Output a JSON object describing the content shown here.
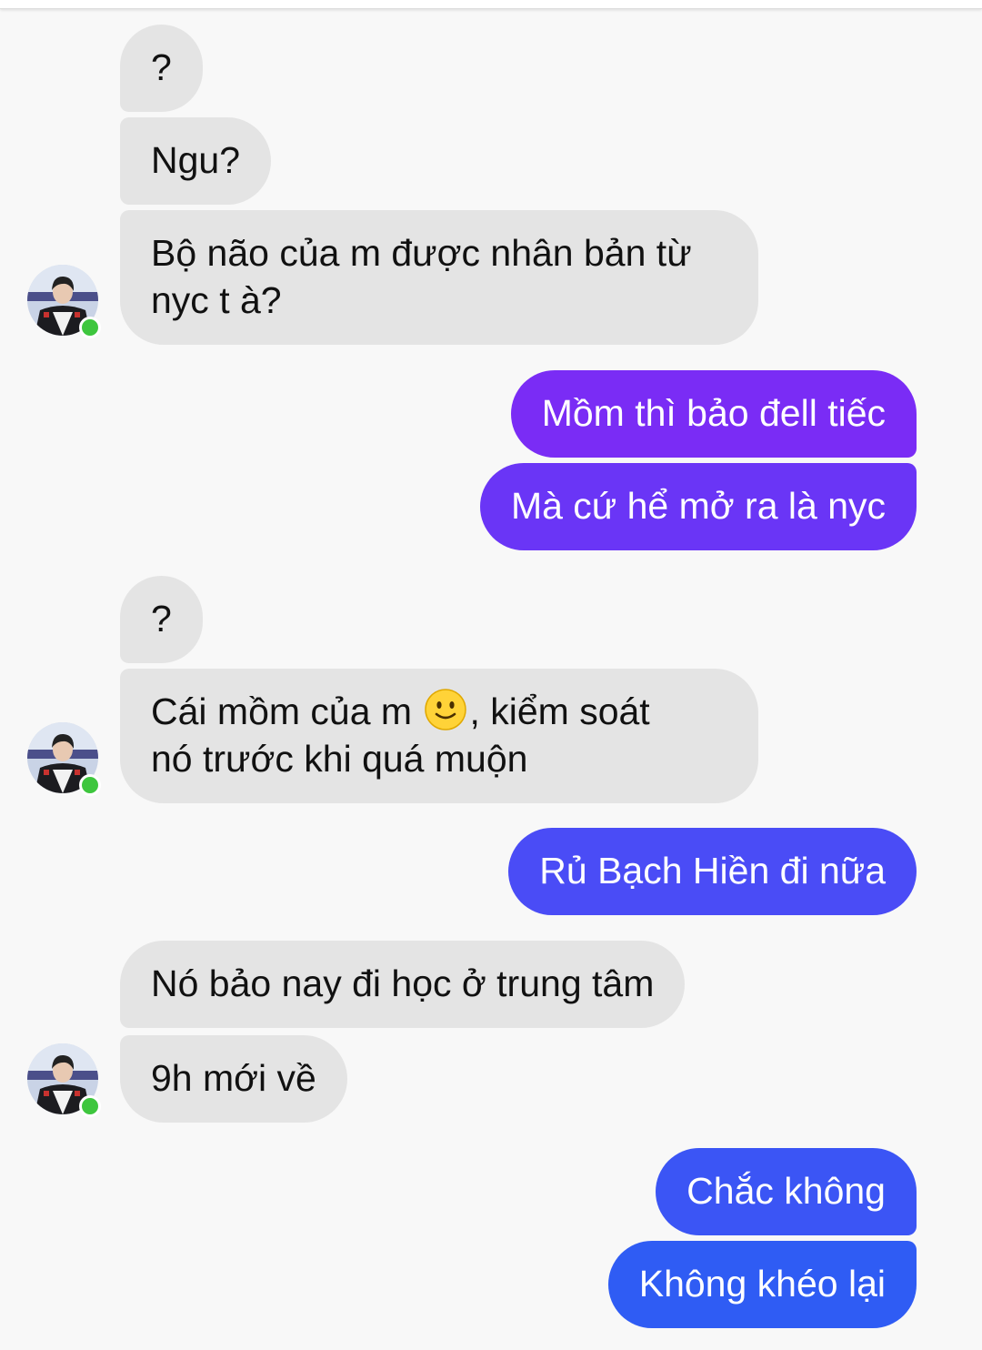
{
  "colors": {
    "background": "#f8f8f8",
    "incoming_bubble": "#e4e4e4",
    "outgoing_gradient": [
      "#7a2cf5",
      "#6a35f6",
      "#4a4cf6",
      "#3b55f5",
      "#2f5cf4"
    ],
    "online": "#3ec63e"
  },
  "messages": [
    {
      "side": "in",
      "text": "?"
    },
    {
      "side": "in",
      "text": "Ngu?"
    },
    {
      "side": "in",
      "line1": "Bộ não của m được nhân bản từ",
      "line2": "nyc t à?"
    },
    {
      "side": "out",
      "text": "Mồm thì bảo đell tiếc"
    },
    {
      "side": "out",
      "text": "Mà cứ hể mở ra là nyc"
    },
    {
      "side": "in",
      "text": "?"
    },
    {
      "side": "in",
      "line1_before_emoji": "Cái mồm của m ",
      "emoji": "slightly-smiling-face",
      "line1_after_emoji": ", kiểm soát",
      "line2": "nó trước khi quá muộn"
    },
    {
      "side": "out",
      "text": "Rủ Bạch Hiền đi nữa"
    },
    {
      "side": "in",
      "text": "Nó bảo nay đi học ở trung tâm"
    },
    {
      "side": "in",
      "text": "9h mới về"
    },
    {
      "side": "out",
      "text": "Chắc không"
    },
    {
      "side": "out",
      "text": "Không khéo lại"
    }
  ],
  "avatar": {
    "icon": "contact-avatar",
    "status": "online"
  }
}
